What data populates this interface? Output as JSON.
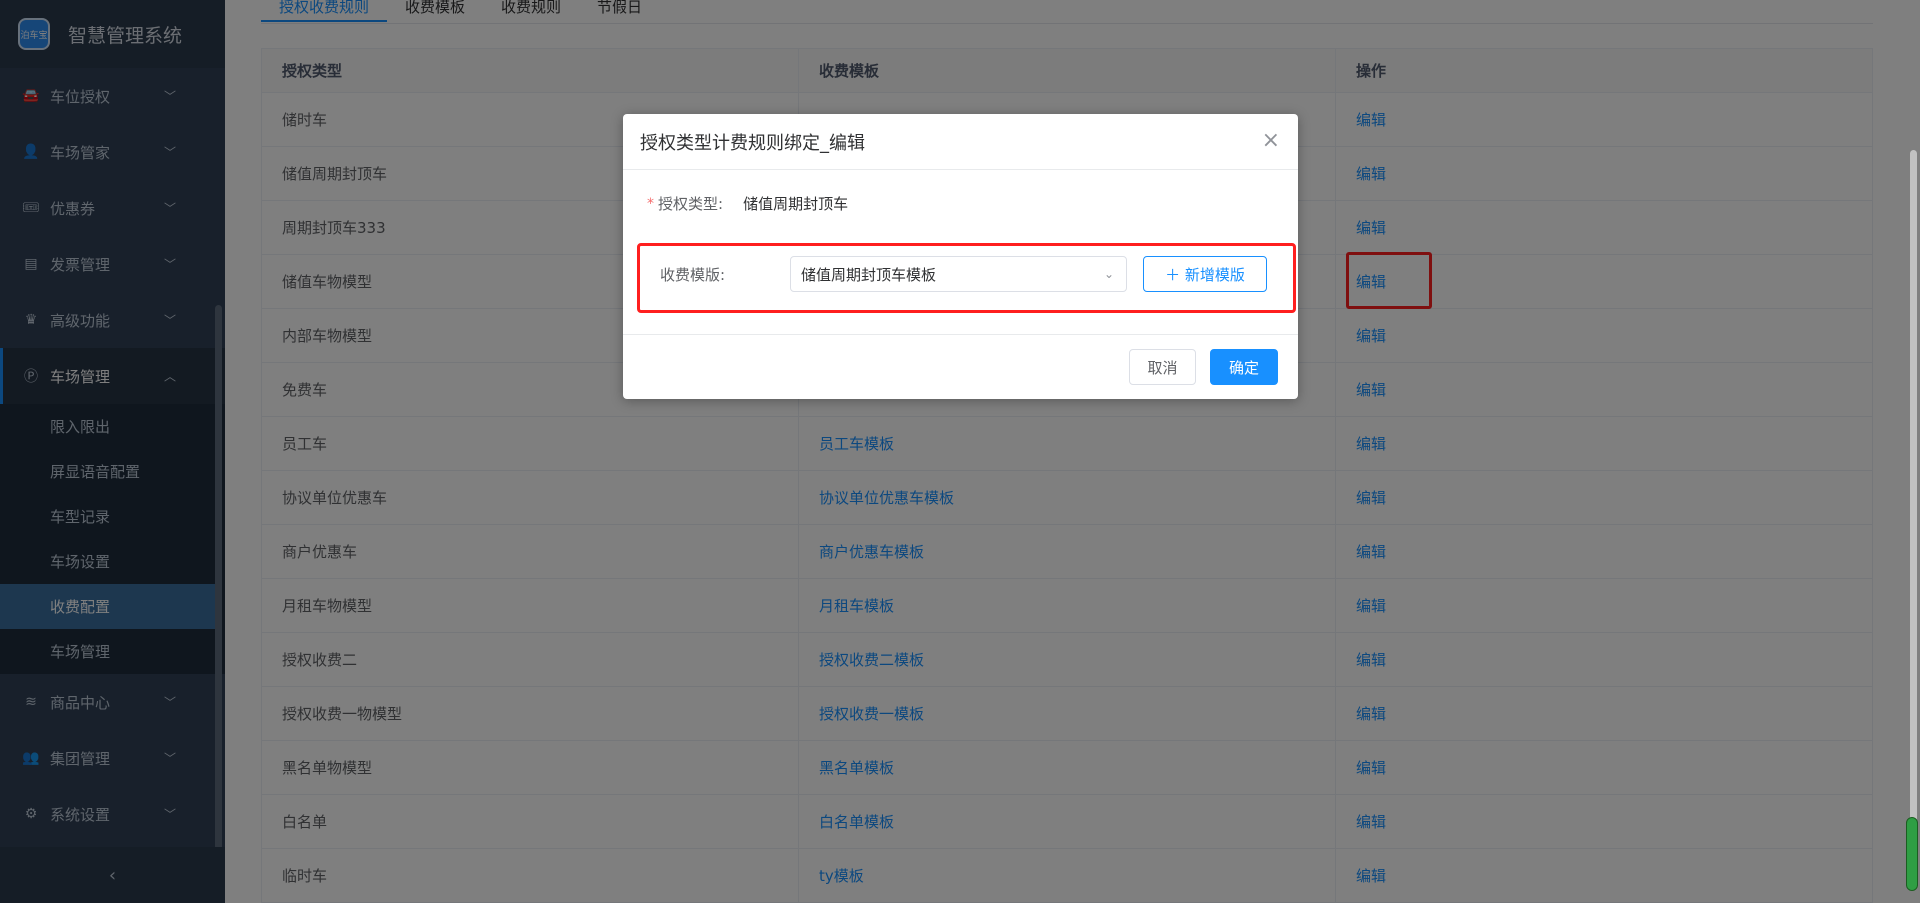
{
  "app": {
    "title": "智慧管理系统",
    "logo_text": "泊车宝"
  },
  "sidebar": {
    "items": [
      {
        "label": "车位授权",
        "icon": "car-icon"
      },
      {
        "label": "车场管家",
        "icon": "user-icon"
      },
      {
        "label": "优惠券",
        "icon": "ticket-icon"
      },
      {
        "label": "发票管理",
        "icon": "invoice-icon"
      },
      {
        "label": "高级功能",
        "icon": "crown-icon"
      },
      {
        "label": "车场管理",
        "icon": "parking-icon",
        "expanded": true
      }
    ],
    "sub_items": [
      "限入限出",
      "屏显语音配置",
      "车型记录",
      "车场设置",
      "收费配置",
      "车场管理"
    ],
    "items_after": [
      {
        "label": "商品中心",
        "icon": "layers-icon"
      },
      {
        "label": "集团管理",
        "icon": "group-icon"
      },
      {
        "label": "系统设置",
        "icon": "gear-icon"
      }
    ],
    "collapse_glyph": "‹"
  },
  "tabs": [
    "授权收费规则",
    "收费模板",
    "收费规则",
    "节假日"
  ],
  "table": {
    "headers": [
      "授权类型",
      "收费模板",
      "操作"
    ],
    "rows": [
      {
        "type": "储时车",
        "template": "",
        "action": "编辑"
      },
      {
        "type": "储值周期封顶车",
        "template": "",
        "action": "编辑"
      },
      {
        "type": "周期封顶车333",
        "template": "",
        "action": "编辑"
      },
      {
        "type": "储值车物模型",
        "template": "",
        "action": "编辑"
      },
      {
        "type": "内部车物模型",
        "template": "",
        "action": "编辑"
      },
      {
        "type": "免费车",
        "template": "",
        "action": "编辑"
      },
      {
        "type": "员工车",
        "template": "员工车模板",
        "action": "编辑"
      },
      {
        "type": "协议单位优惠车",
        "template": "协议单位优惠车模板",
        "action": "编辑"
      },
      {
        "type": "商户优惠车",
        "template": "商户优惠车模板",
        "action": "编辑"
      },
      {
        "type": "月租车物模型",
        "template": "月租车模板",
        "action": "编辑"
      },
      {
        "type": "授权收费二",
        "template": "授权收费二模板",
        "action": "编辑"
      },
      {
        "type": "授权收费一物模型",
        "template": "授权收费一模板",
        "action": "编辑"
      },
      {
        "type": "黑名单物模型",
        "template": "黑名单模板",
        "action": "编辑"
      },
      {
        "type": "白名单",
        "template": "白名单模板",
        "action": "编辑"
      },
      {
        "type": "临时车",
        "template": "ty模板",
        "action": "编辑"
      }
    ]
  },
  "dialog": {
    "title": "授权类型计费规则绑定_编辑",
    "close_glyph": "×",
    "auth_type_label": "授权类型:",
    "auth_type_value": "储值周期封顶车",
    "template_label": "收费模版:",
    "template_value": "储值周期封顶车模板",
    "add_button": "＋ 新增模版",
    "cancel": "取消",
    "ok": "确定"
  },
  "colors": {
    "primary": "#1890ff",
    "sidebar": "#304156",
    "highlight": "#ff1f1f"
  }
}
